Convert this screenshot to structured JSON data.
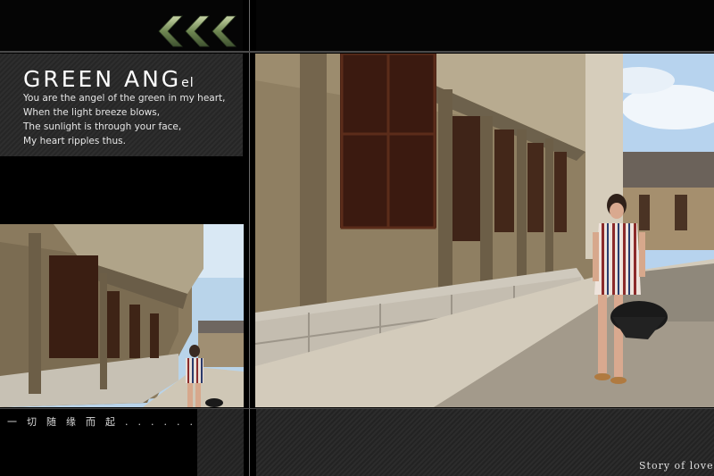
{
  "title": {
    "main": "GREEN ANG",
    "small": "el"
  },
  "poem": [
    "You are the angel of the green in my heart,",
    "When the light breeze blows,",
    "The sunlight is through your face,",
    "My heart ripples thus."
  ],
  "caption_cn": "一切随缘而起......",
  "caption_en": "Story of love",
  "decor": {
    "chevron_icon": "triple-chevron-left",
    "chevron_color": "#7a8f5a"
  },
  "photos": {
    "small": "woman in striped shirt walking beside stone building",
    "large": "woman in striped shirt walking beside stone building"
  }
}
